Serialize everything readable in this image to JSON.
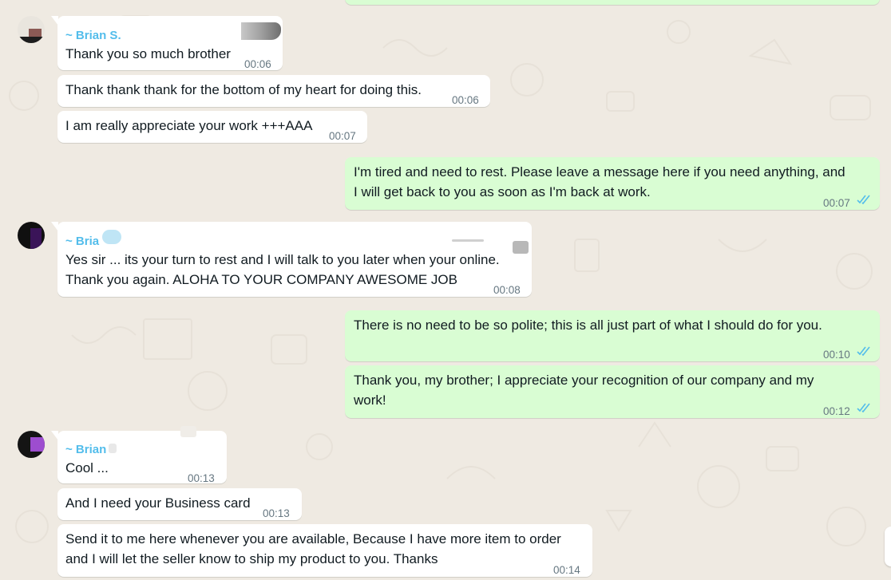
{
  "colors": {
    "incoming": "#ffffff",
    "outgoing": "#d9fdd3",
    "sender": "#53bdeb",
    "time": "#667781",
    "read_ticks": "#53bdeb"
  },
  "messages": [
    {
      "sender": "~ Brian S.",
      "text": "Thank you so much brother",
      "time": "00:06"
    },
    {
      "text": "Thank thank thank for the bottom of my heart for doing this.",
      "time": "00:06"
    },
    {
      "text": "I am really appreciate your work +++AAA",
      "time": "00:07"
    },
    {
      "lines": [
        "I'm tired and need to rest. Please leave a message here if you need anything, and",
        "I will get back to you as soon as I'm back at work."
      ],
      "time": "00:07"
    },
    {
      "sender": "~ Bria",
      "lines": [
        "Yes sir ... its your turn to rest and I will talk to you later when your online.",
        "Thank you again. ALOHA TO YOUR COMPANY AWESOME JOB"
      ],
      "time": "00:08"
    },
    {
      "text": "There is no need to be so polite; this is all just part of what I should do for you.",
      "time": "00:10"
    },
    {
      "lines": [
        "Thank you, my brother; I appreciate your recognition of our company and my",
        "work!"
      ],
      "time": "00:12"
    },
    {
      "sender": "~ Brian",
      "text": "Cool ...",
      "time": "00:13"
    },
    {
      "text": "And I need your Business card",
      "time": "00:13"
    },
    {
      "lines": [
        "Send it to me here whenever you are available, Because I have more item to order",
        "and I will let the seller know to ship my product to you. Thanks"
      ],
      "time": "00:14"
    }
  ]
}
